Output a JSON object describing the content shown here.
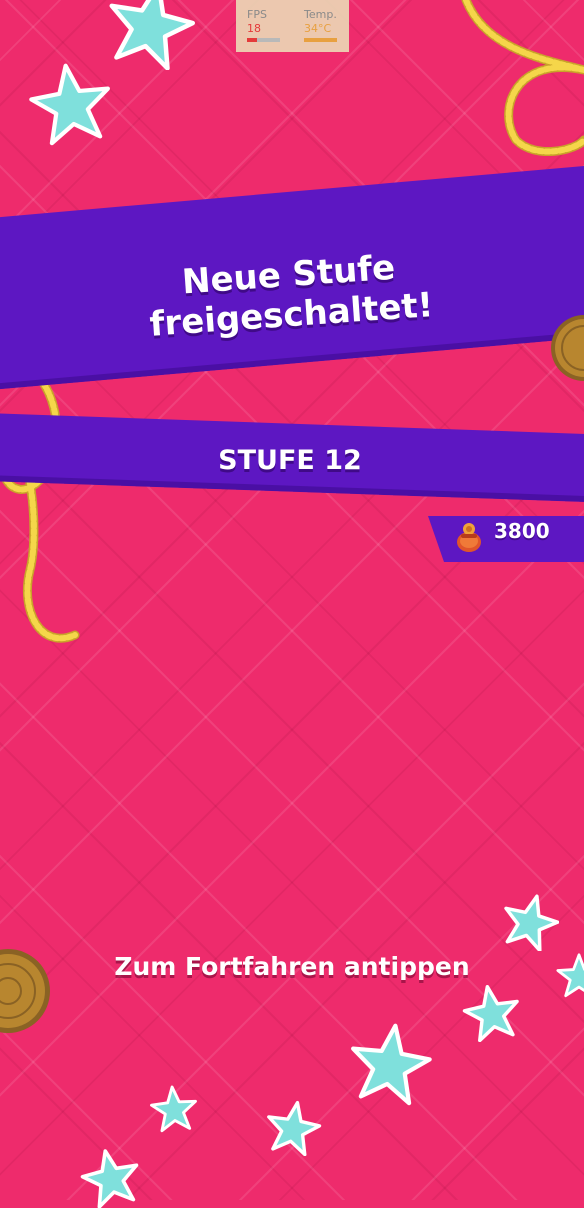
{
  "stats_overlay": {
    "fps_label": "FPS",
    "fps_value": "18",
    "temp_label": "Temp.",
    "temp_value": "34°C"
  },
  "banner": {
    "title_line1": "Neue Stufe",
    "title_line2": "freigeschaltet!"
  },
  "level": {
    "label": "STUFE 12"
  },
  "currency": {
    "icon": "coin-pouch-icon",
    "amount": "3800"
  },
  "prompt": {
    "tap_to_continue": "Zum Fortfahren antippen"
  },
  "colors": {
    "background": "#ee2b6c",
    "banner": "#5d17c2",
    "rope": "#f5d64a",
    "star": "#7fe0dc",
    "coin": "#b8862f"
  }
}
